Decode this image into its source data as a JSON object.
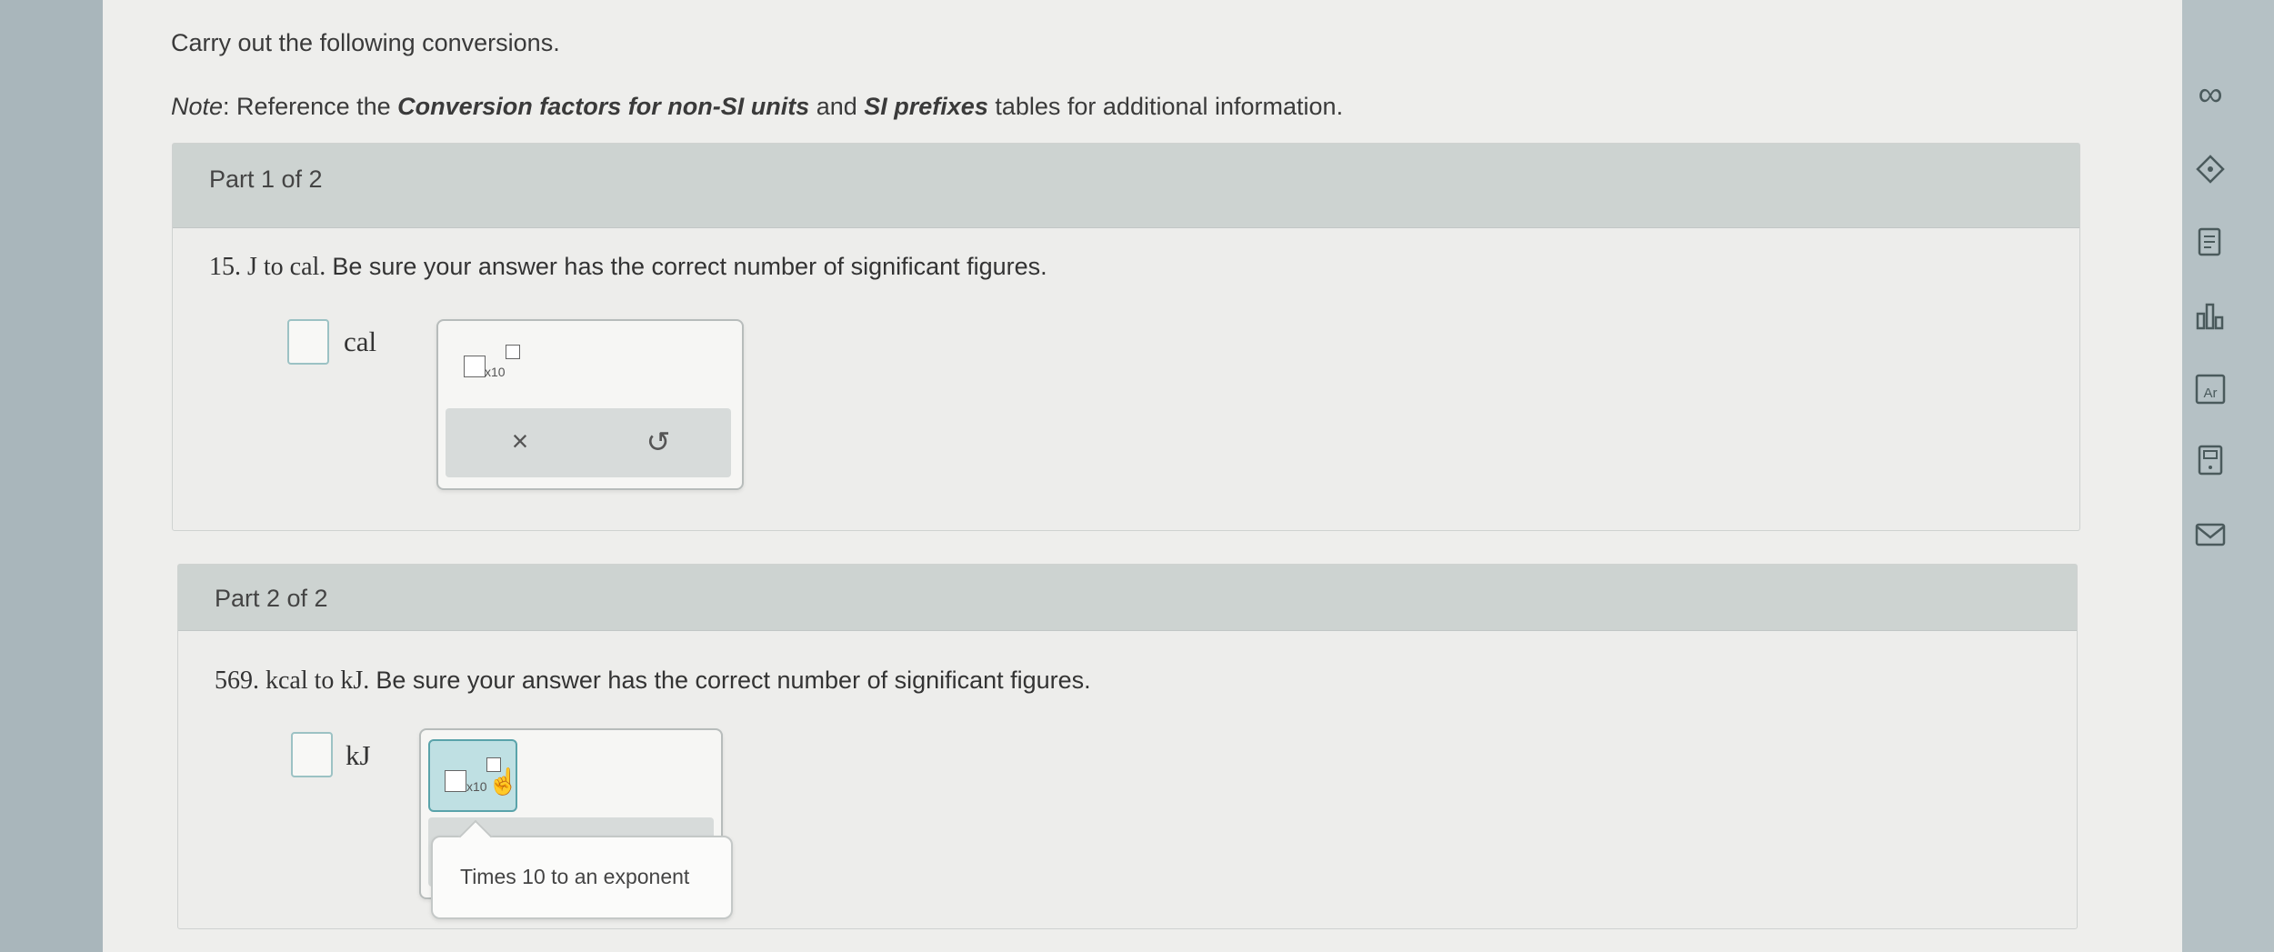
{
  "instructions": "Carry out the following conversions.",
  "note": {
    "prefix": "Note",
    "text1": ": Reference the ",
    "link1": "Conversion factors for non-SI units",
    "text2": " and ",
    "link2": "SI prefixes",
    "text3": " tables for additional information."
  },
  "parts": [
    {
      "title": "Part 1 of 2",
      "question_number": "15.",
      "question_units": "J to cal.",
      "question_rest": "Be sure your answer has the correct number of significant figures.",
      "unit": "cal",
      "x10_label": "x10",
      "clear_icon": "×",
      "undo_icon": "↺"
    },
    {
      "title": "Part 2 of 2",
      "question_number": "569.",
      "question_units": "kcal to kJ.",
      "question_rest": "Be sure your answer has the correct number of significant figures.",
      "unit": "kJ",
      "x10_label": "x10",
      "tooltip": "Times 10 to an exponent"
    }
  ],
  "sidebar_icons": [
    {
      "name": "infinity-icon",
      "glyph": "∞"
    },
    {
      "name": "tag-icon",
      "glyph": "◈"
    },
    {
      "name": "checklist-icon",
      "glyph": "☰"
    },
    {
      "name": "bar-chart-icon",
      "glyph": "ılı"
    },
    {
      "name": "periodic-table-icon",
      "glyph": "Ar"
    },
    {
      "name": "calculator-icon",
      "glyph": "▦"
    },
    {
      "name": "mail-icon",
      "glyph": "✉"
    }
  ],
  "colors": {
    "background": "#a9b6bb",
    "page": "#eeeeec",
    "part_header": "#cdd3d1",
    "answer_border": "#9cc2c4",
    "active_button": "#bfe0e3"
  }
}
